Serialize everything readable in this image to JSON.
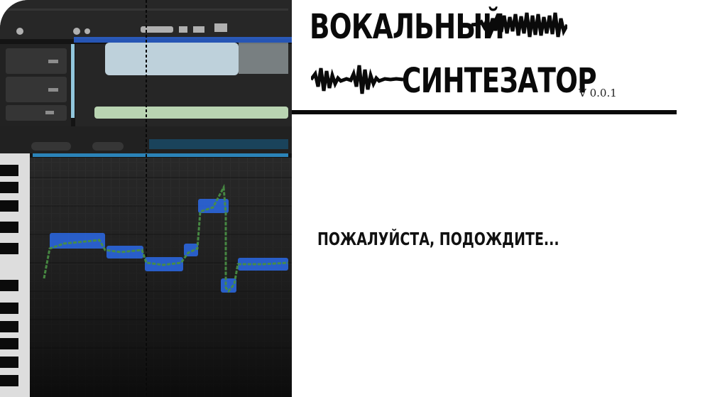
{
  "title": {
    "line1": "ВОКАЛЬНЫЙ",
    "line2": "СИНТЕЗАТОР"
  },
  "version": "V 0.0.1",
  "status": "ПОЖАЛУЙСТА, ПОДОЖДИТЕ...",
  "colors": {
    "accent_blue": "#2f6ff0",
    "pitch_green": "#4f9a4a",
    "panel_dark": "#161616",
    "text": "#0a0a0a"
  }
}
